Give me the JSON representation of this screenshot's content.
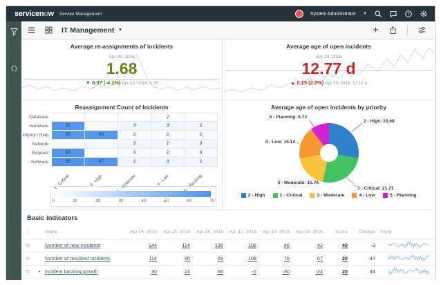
{
  "header": {
    "logo_part1": "servicen",
    "logo_o": "o",
    "logo_part2": "w",
    "product": "Service Management",
    "user_name": "System Administrator"
  },
  "toolbar": {
    "dashboard": "IT Management"
  },
  "scorecards": [
    {
      "title": "Average re-assignments of incidents",
      "date": "Apr 20, 2016",
      "value": "1.68",
      "delta": "▼ 0.07 (-4.1%)",
      "previous": "Apr 19, 2016: 1.75",
      "value_color": "#67821d",
      "delta_color": "#387c0c"
    },
    {
      "title": "Average age of open incidents",
      "date": "Apr 20, 2016",
      "value": "12.77 d",
      "delta": "▲ 0.25 (2.0%)",
      "previous": "Apr 19, 2016: 12.52 d",
      "value_color": "#c9252b",
      "delta_color": "#c9252b"
    }
  ],
  "heatmap": {
    "title": "Reassignment Count of Incidents",
    "rows": [
      "Database",
      "Hardware",
      "Inquiry / Help",
      "Network",
      "Request",
      "Software"
    ],
    "columns": [
      "1 - Critical",
      "2 - High",
      "3 - Moderate",
      "4 - Low",
      "5 - Planning"
    ],
    "values": [
      [
        null,
        null,
        null,
        2,
        null
      ],
      [
        65,
        null,
        3,
        3,
        2
      ],
      [
        65,
        66,
        2,
        2,
        2
      ],
      [
        null,
        null,
        3,
        2,
        3
      ],
      [
        67,
        null,
        3,
        2,
        3
      ],
      [
        68,
        67,
        2,
        3,
        2
      ]
    ],
    "scale_ticks": [
      "0",
      "10",
      "20",
      "30",
      "40",
      "50",
      "60",
      "70"
    ],
    "scale_max": 70,
    "high_color": "#4e8fe6"
  },
  "donut": {
    "title": "Average age of open incidents by priority",
    "slices": [
      {
        "label": "2 - High",
        "value": 23.68,
        "color": "#2d82c8",
        "callout": "2 - High: 23.68"
      },
      {
        "label": "1 - Critical",
        "value": 21.71,
        "color": "#43c363",
        "callout": "1 - Critical: 21.71"
      },
      {
        "label": "3 - Moderate",
        "value": 15.76,
        "color": "#fcc33d",
        "callout": "3 - Moderate: 15.76"
      },
      {
        "label": "4 - Low",
        "value": 15.14,
        "color": "#f8982e",
        "callout": "4 - Low: 15.14"
      },
      {
        "label": "5 - Planning",
        "value": 8.73,
        "color": "#d320d3",
        "callout": "5 - Planning: 8.73"
      }
    ]
  },
  "indicators": {
    "title": "Basic indicators",
    "columns": [
      "Name",
      "Apr 14, 2016",
      "Apr 15, 2016",
      "Apr 16, 2016",
      "Apr 17, 2016",
      "Apr 18, 2016",
      "Apr 19, 2016",
      "Score",
      "Change",
      "Trend"
    ],
    "rows": [
      {
        "name": "Number of new incidents",
        "values": [
          "144",
          "114",
          "135",
          "106",
          "46",
          "43"
        ],
        "score": "40",
        "change": "-3",
        "bullet": false
      },
      {
        "name": "Number of resolved incidents",
        "values": [
          "114",
          "90",
          "69",
          "108",
          "76",
          "67"
        ],
        "score": "20",
        "change": "-47",
        "bullet": false
      },
      {
        "name": "Incident backlog growth",
        "values": [
          "30",
          "24",
          "66",
          "-2",
          "-30",
          "-24"
        ],
        "score": "20",
        "change": "44",
        "bullet": true
      }
    ]
  },
  "chart_data": [
    {
      "type": "line",
      "title": "Average re-assignments of incidents",
      "current_date": "Apr 20, 2016",
      "current_value": 1.68,
      "change": -0.07,
      "change_pct": "-4.1%",
      "previous_date": "Apr 19, 2016",
      "previous_value": 1.75
    },
    {
      "type": "line",
      "title": "Average age of open incidents",
      "current_date": "Apr 20, 2016",
      "current_value": "12.77 d",
      "change": 0.25,
      "change_pct": "2.0%",
      "previous_date": "Apr 19, 2016",
      "previous_value": "12.52 d"
    },
    {
      "type": "heatmap",
      "title": "Reassignment Count of Incidents",
      "rows": [
        "Database",
        "Hardware",
        "Inquiry / Help",
        "Network",
        "Request",
        "Software"
      ],
      "columns": [
        "1 - Critical",
        "2 - High",
        "3 - Moderate",
        "4 - Low",
        "5 - Planning"
      ],
      "values": [
        [
          null,
          null,
          null,
          2,
          null
        ],
        [
          65,
          null,
          3,
          3,
          2
        ],
        [
          65,
          66,
          2,
          2,
          2
        ],
        [
          null,
          null,
          3,
          2,
          3
        ],
        [
          67,
          null,
          3,
          2,
          3
        ],
        [
          68,
          67,
          2,
          3,
          2
        ]
      ],
      "colorbar_range": [
        0,
        70
      ]
    },
    {
      "type": "pie",
      "title": "Average age of open incidents by priority",
      "labels": [
        "2 - High",
        "1 - Critical",
        "3 - Moderate",
        "4 - Low",
        "5 - Planning"
      ],
      "values": [
        23.68,
        21.71,
        15.76,
        15.14,
        8.73
      ],
      "legend_position": "bottom"
    },
    {
      "type": "table",
      "title": "Basic indicators",
      "columns": [
        "Name",
        "Apr 14, 2016",
        "Apr 15, 2016",
        "Apr 16, 2016",
        "Apr 17, 2016",
        "Apr 18, 2016",
        "Apr 19, 2016",
        "Score",
        "Change"
      ],
      "rows": [
        [
          "Number of new incidents",
          144,
          114,
          135,
          106,
          46,
          43,
          40,
          -3
        ],
        [
          "Number of resolved incidents",
          114,
          90,
          69,
          108,
          76,
          67,
          20,
          -47
        ],
        [
          "Incident backlog growth",
          30,
          24,
          66,
          -2,
          -30,
          -24,
          20,
          44
        ]
      ]
    }
  ]
}
